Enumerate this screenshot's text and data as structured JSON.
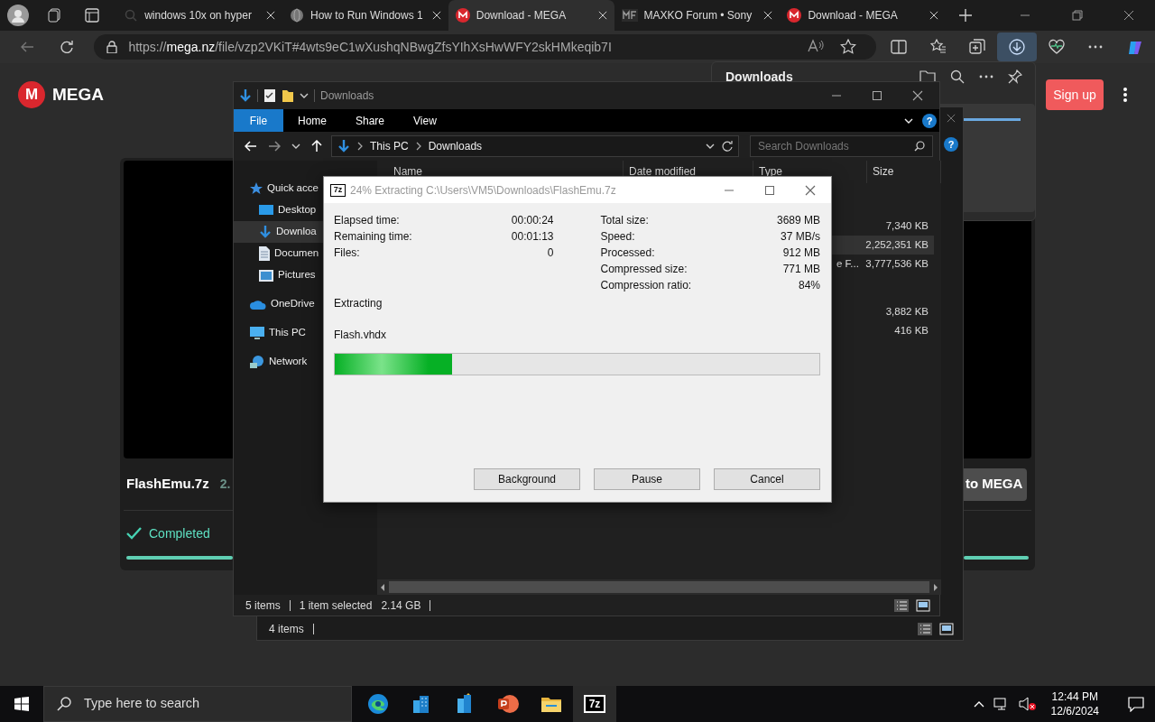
{
  "browser": {
    "tabs": [
      {
        "title": "windows 10x on hyper",
        "kind": "search",
        "selected": false
      },
      {
        "title": "How to Run Windows 1",
        "kind": "globe",
        "selected": false
      },
      {
        "title": "Download - MEGA",
        "kind": "mega",
        "selected": true
      },
      {
        "title": "MAXKO Forum • Sony",
        "kind": "forum",
        "selected": false
      },
      {
        "title": "Download - MEGA",
        "kind": "mega",
        "selected": false
      }
    ],
    "address": {
      "prefix": "https://",
      "host": "mega.nz",
      "path": "/file/vzp2VKiT#4wts9eC1wXushqNBwgZfsYIhXsHwWFY2skHMkeqib7I"
    },
    "downloads_open": true
  },
  "mega": {
    "logo_mark": "M",
    "logo_text": "MEGA",
    "signup": "Sign up",
    "file_name": "FlashEmu.7z",
    "file_size": "2.",
    "import_button": "to MEGA",
    "status": "Completed",
    "level": 1
  },
  "downloads_panel": {
    "title": "Downloads"
  },
  "back_explorer": {
    "help": "?",
    "status": [
      [
        "4 items"
      ]
    ]
  },
  "explorer": {
    "title": "Downloads",
    "ribbon_tabs": [
      {
        "label": "File",
        "selected": true
      },
      {
        "label": "Home",
        "selected": false
      },
      {
        "label": "Share",
        "selected": false
      },
      {
        "label": "View",
        "selected": false
      }
    ],
    "help": "?",
    "breadcrumb": [
      "This PC",
      "Downloads"
    ],
    "search": {
      "placeholder": "Search Downloads"
    },
    "columns": [
      "Name",
      "Date modified",
      "Type",
      "Size"
    ],
    "nav": [
      {
        "label": "Quick acce",
        "kind": "star",
        "selected": false,
        "children": [
          {
            "label": "Desktop",
            "kind": "desktop",
            "selected": false
          },
          {
            "label": "Downloa",
            "kind": "download",
            "selected": true
          },
          {
            "label": "Documen",
            "kind": "document",
            "selected": false
          },
          {
            "label": "Pictures",
            "kind": "pictures",
            "selected": false
          }
        ]
      },
      {
        "label": "OneDrive",
        "kind": "cloud",
        "selected": false
      },
      {
        "label": "This PC",
        "kind": "pc",
        "selected": false
      },
      {
        "label": "Network",
        "kind": "network",
        "selected": false
      }
    ],
    "groups": [
      {
        "rows": [
          {
            "type": "",
            "size": "7,340 KB",
            "selected": false
          },
          {
            "type": "",
            "size": "2,252,351 KB",
            "selected": true
          },
          {
            "type": "e F...",
            "size": "3,777,536 KB",
            "selected": false
          }
        ]
      },
      {
        "rows": [
          {
            "type": "",
            "size": "3,882 KB",
            "selected": false
          },
          {
            "type": "",
            "size": "416 KB",
            "selected": false
          }
        ]
      }
    ],
    "status": [
      [
        "5 items"
      ],
      [
        "1 item selected",
        "2.14 GB"
      ]
    ]
  },
  "sevenzip": {
    "icon": "7z",
    "title": "24% Extracting C:\\Users\\VM5\\Downloads\\FlashEmu.7z",
    "left_stats": [
      {
        "label": "Elapsed time:",
        "value": "00:00:24"
      },
      {
        "label": "Remaining time:",
        "value": "00:01:13"
      },
      {
        "label": "Files:",
        "value": "0"
      }
    ],
    "right_stats": [
      {
        "label": "Total size:",
        "value": "3689 MB"
      },
      {
        "label": "Speed:",
        "value": "37 MB/s"
      },
      {
        "label": "Processed:",
        "value": "912 MB"
      },
      {
        "label": "Compressed size:",
        "value": "771 MB"
      },
      {
        "label": "Compression ratio:",
        "value": "84%"
      }
    ],
    "action": "Extracting",
    "current_file": "Flash.vhdx",
    "level": 0.243,
    "buttons": [
      "Background",
      "Pause",
      "Cancel"
    ]
  },
  "taskbar": {
    "search": {
      "placeholder": "Type here to search"
    },
    "apps": [
      {
        "kind": "edge",
        "selected": false
      },
      {
        "kind": "buildings",
        "selected": false
      },
      {
        "kind": "buildings2",
        "selected": false
      },
      {
        "kind": "powerpoint",
        "selected": false
      },
      {
        "kind": "explorer",
        "selected": false
      },
      {
        "kind": "sevenzip",
        "label": "7z",
        "selected": true
      }
    ],
    "time": "12:44 PM",
    "date": "12/6/2024"
  }
}
